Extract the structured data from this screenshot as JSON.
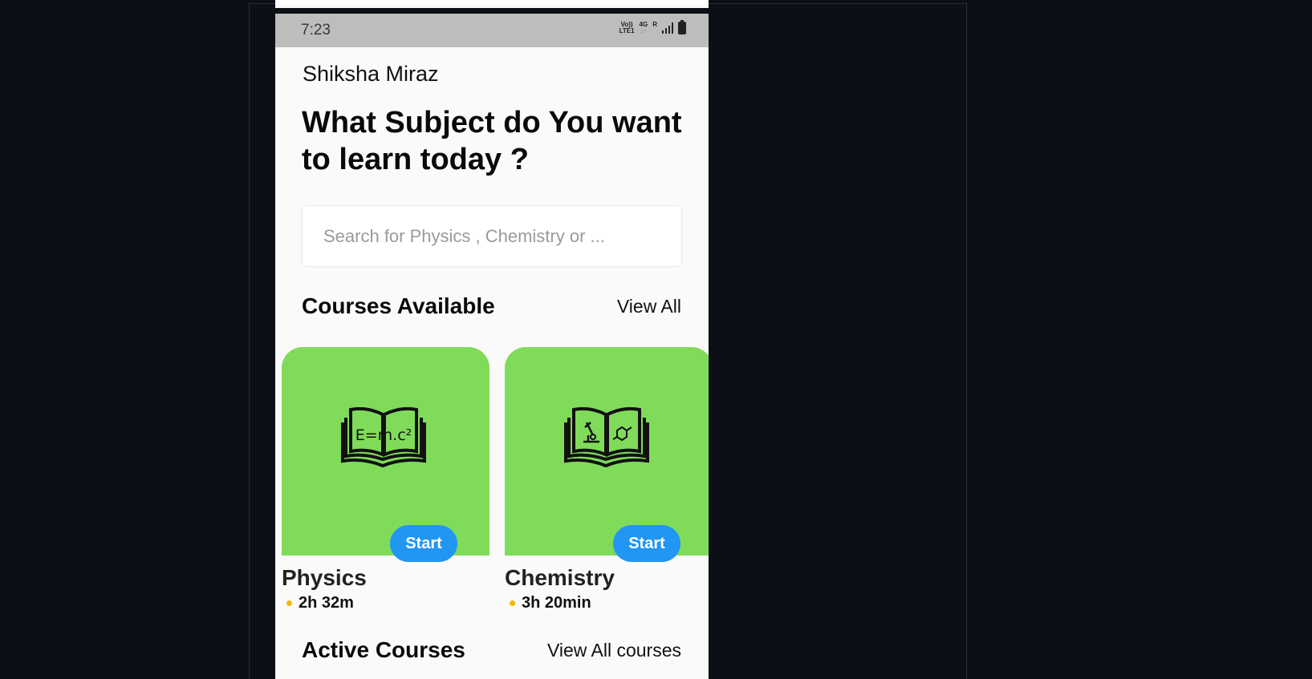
{
  "status_bar": {
    "time": "7:23",
    "volte_top": "Vo))",
    "volte_bottom": "LTE1",
    "network_top": "4G",
    "network_bottom": "↓↑",
    "roaming": "R"
  },
  "header": {
    "app_name": "Shiksha Miraz",
    "headline": "What Subject do You want\n to learn today ?"
  },
  "search": {
    "placeholder": "Search for Physics , Chemistry or ...",
    "value": ""
  },
  "courses_section": {
    "title": "Courses Available",
    "link": "View All"
  },
  "courses": [
    {
      "name": "Physics",
      "duration": "2h 32m",
      "button": "Start",
      "icon": "book-physics-icon",
      "book_text": "E=m.c²"
    },
    {
      "name": "Chemistry",
      "duration": "3h 20min",
      "button": "Start",
      "icon": "book-chemistry-icon"
    }
  ],
  "active_section": {
    "title": "Active Courses",
    "link": "View All courses"
  },
  "colors": {
    "card_bg": "#80db5a",
    "button": "#2196f3",
    "dot": "#f5b800",
    "status_bar": "#bdbdbd"
  }
}
